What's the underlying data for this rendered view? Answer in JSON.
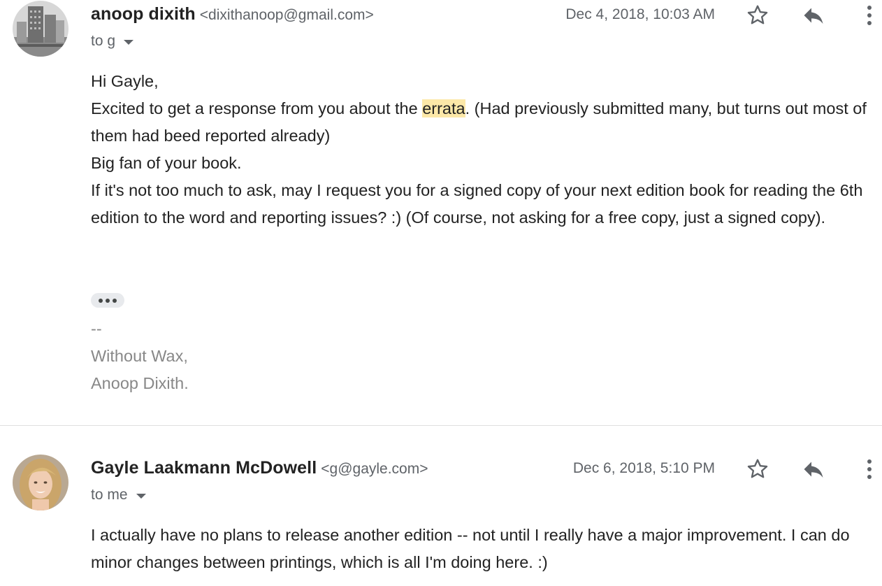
{
  "messages": [
    {
      "sender_name": "anoop dixith",
      "sender_email": "<dixithanoop@gmail.com>",
      "date": "Dec 4, 2018, 10:03 AM",
      "to": "to g",
      "body": {
        "greeting": "Hi Gayle,",
        "line1_pre": "Excited to get a response from you about the ",
        "line1_highlight": "errata",
        "line1_post": ". (Had previously submitted many, but turns out most of them had beed reported already)",
        "line2": "Big fan of your book.",
        "line3": "If it's not too much to ask, may I request you for a signed copy of your next edition book for reading the 6th edition to the word and reporting issues? :) (Of course, not asking for a free copy, just a signed copy)."
      },
      "signature": {
        "dashes": "--",
        "line1": "Without Wax,",
        "line2": "Anoop Dixith."
      }
    },
    {
      "sender_name": "Gayle Laakmann McDowell",
      "sender_email": "<g@gayle.com>",
      "date": "Dec 6, 2018, 5:10 PM",
      "to": "to me",
      "body": {
        "text": "I actually have no plans to release another edition -- not until I really have a major improvement. I can do minor changes between printings, which is all I'm doing here. :)"
      }
    }
  ],
  "icons": {
    "star": "star-icon",
    "reply": "reply-icon",
    "more": "more-vertical-icon",
    "trimmed": "show-trimmed-content-icon",
    "dropdown": "chevron-down-icon"
  },
  "colors": {
    "highlight": "#fce8a8",
    "secondary_text": "#5f6368",
    "signature_text": "#888888"
  }
}
